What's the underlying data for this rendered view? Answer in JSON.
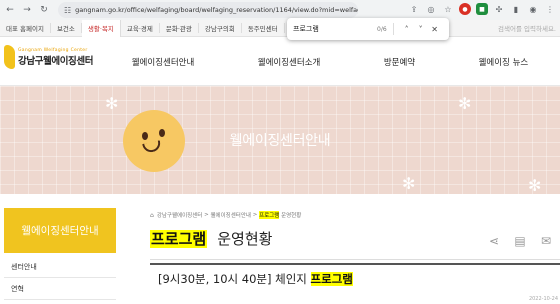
{
  "browser": {
    "url": "gangnam.go.kr/office/welfaging/board/welfaging_reservation/1164/view.do?mid=welfaging_status"
  },
  "find_bar": {
    "query": "프로그램",
    "count": "0/6",
    "prev_icon": "chevron-up-icon",
    "next_icon": "chevron-down-icon",
    "close_icon": "close-icon"
  },
  "gov_links": {
    "items": [
      "대표 홈페이지",
      "보건소",
      "생활·복지",
      "교육·경제",
      "문화·관광",
      "강남구의회",
      "동주민센터"
    ],
    "active_index": 2,
    "search_placeholder": "검색어를 입력하세요."
  },
  "header": {
    "logo_en": "Gangnam Welfaging Center",
    "logo_ko": "강남구웰에이징센터",
    "gnb": [
      "웰에이징센터안내",
      "웰에이징센터소개",
      "방문예약",
      "웰에이징 뉴스"
    ]
  },
  "banner": {
    "title": "웰에이징센터안내"
  },
  "sidebar": {
    "title": "웰에이징센터안내",
    "items": [
      "센터안내",
      "연혁"
    ]
  },
  "breadcrumb": {
    "items": [
      "강남구웰에이징센터",
      "웰에이징센터안내"
    ],
    "current_highlight": "프로그램",
    "current_rest": "운영현황"
  },
  "page": {
    "title_highlight": "프로그램",
    "title_rest": "운영현황"
  },
  "post": {
    "title_prefix": "[9시30분, 10시 40분] 체인지",
    "title_highlight": "프로그램",
    "date": "2022-10-24"
  },
  "colors": {
    "accent_yellow": "#f0c41f",
    "banner_bg": "#eed8cf",
    "highlight": "#ffff00",
    "active_link": "#c62828"
  }
}
